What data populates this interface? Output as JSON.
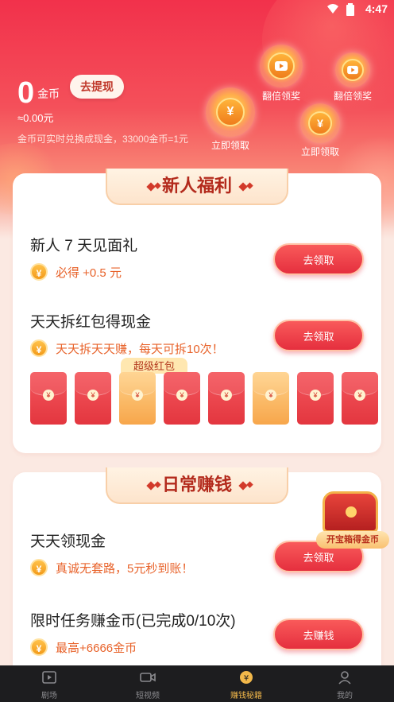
{
  "status_bar": {
    "time": "4:47"
  },
  "header": {
    "coins_value": "0",
    "coins_unit": "金币",
    "withdraw_label": "去提现",
    "cash_value": "≈0.00元",
    "rate_text": "金币可实时兑换成现金，33000金币=1元"
  },
  "bubbles": [
    {
      "label": "翻倍领奖",
      "icon": "video-icon"
    },
    {
      "label": "翻倍领奖",
      "icon": "video-icon"
    },
    {
      "label": "立即领取",
      "icon": "yen-coin-icon",
      "symbol": "¥"
    },
    {
      "label": "立即领取",
      "icon": "yen-coin-icon",
      "symbol": "¥"
    }
  ],
  "newbie": {
    "heading": "新人福利",
    "tasks": [
      {
        "title": "新人 7 天见面礼",
        "reward": "必得 +0.5 元",
        "button": "去领取"
      },
      {
        "title": "天天拆红包得现金",
        "reward": "天天拆天天赚，每天可拆10次！",
        "button": "去领取"
      }
    ],
    "super_tag": "超级红包",
    "packet_count": 8,
    "packet_gold_indices": [
      2,
      5
    ]
  },
  "daily": {
    "heading": "日常赚钱",
    "tasks": [
      {
        "title": "天天领现金",
        "reward": "真诚无套路，5元秒到账！",
        "button": "去领取"
      },
      {
        "title": "限时任务赚金币(已完成0/10次)",
        "reward": "最高+6666金币",
        "button": "去赚钱"
      }
    ],
    "treasure_label": "开宝箱得金币"
  },
  "nav": [
    {
      "label": "剧场",
      "icon": "theater-icon",
      "active": false
    },
    {
      "label": "短视频",
      "icon": "video-camera-icon",
      "active": false
    },
    {
      "label": "赚钱秘籍",
      "icon": "yen-coin-icon",
      "active": true
    },
    {
      "label": "我的",
      "icon": "person-icon",
      "active": false
    }
  ],
  "colors": {
    "primary_red": "#e52f3e",
    "reward_orange": "#e8632b",
    "nav_active": "#f2b84a",
    "nav_bg": "#1d1d1f"
  }
}
